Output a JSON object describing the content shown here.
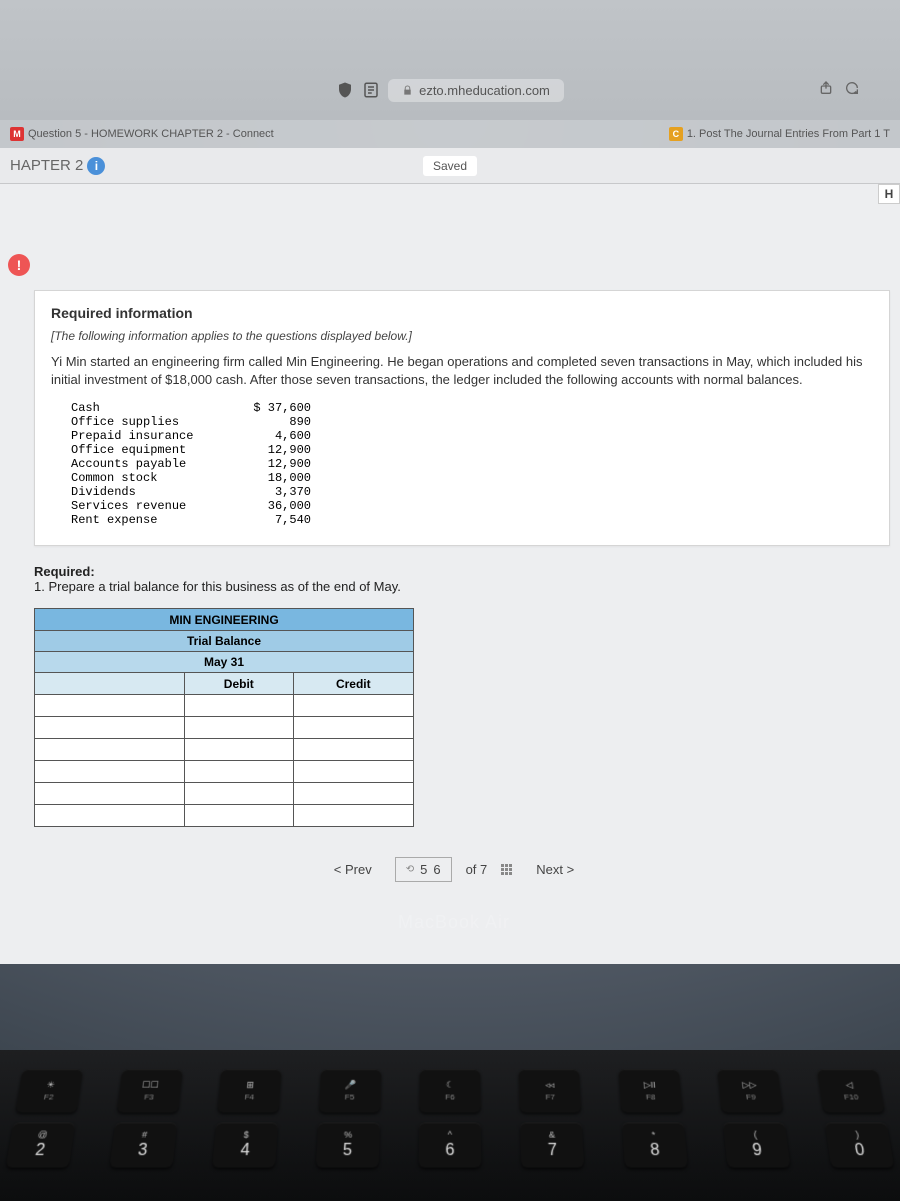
{
  "browser": {
    "url_host": "ezto.mheducation.com"
  },
  "tabs": {
    "left": {
      "icon": "M",
      "label": "Question 5 - HOMEWORK CHAPTER 2 - Connect"
    },
    "right": {
      "icon": "C",
      "label": "1. Post The Journal Entries From Part 1 T"
    }
  },
  "toolbar": {
    "chapter": "HAPTER 2",
    "saved": "Saved",
    "help": "H"
  },
  "alert_glyph": "!",
  "info_card": {
    "heading": "Required information",
    "instruction": "[The following information applies to the questions displayed below.]",
    "body": "Yi Min started an engineering firm called Min Engineering. He began operations and completed seven transactions in May, which included his initial investment of $18,000 cash. After those seven transactions, the ledger included the following accounts with normal balances."
  },
  "ledger": [
    {
      "name": "Cash",
      "amount": "$ 37,600"
    },
    {
      "name": "Office supplies",
      "amount": "890"
    },
    {
      "name": "Prepaid insurance",
      "amount": "4,600"
    },
    {
      "name": "Office equipment",
      "amount": "12,900"
    },
    {
      "name": "Accounts payable",
      "amount": "12,900"
    },
    {
      "name": "Common stock",
      "amount": "18,000"
    },
    {
      "name": "Dividends",
      "amount": "3,370"
    },
    {
      "name": "Services revenue",
      "amount": "36,000"
    },
    {
      "name": "Rent expense",
      "amount": "7,540"
    }
  ],
  "required": {
    "label": "Required:",
    "item1": "1. Prepare a trial balance for this business as of the end of May."
  },
  "trial_balance": {
    "title": "MIN ENGINEERING",
    "subtitle": "Trial Balance",
    "date": "May 31",
    "col_debit": "Debit",
    "col_credit": "Credit"
  },
  "nav": {
    "prev": "< Prev",
    "page_a": "5",
    "page_b": "6",
    "of": "of 7",
    "next": "Next >"
  },
  "device_label": "MacBook Air",
  "keyboard": {
    "fn_row": [
      {
        "icon": "☀",
        "fn": "F2"
      },
      {
        "icon": "☐☐",
        "fn": "F3"
      },
      {
        "icon": "⊞",
        "fn": "F4"
      },
      {
        "icon": "🎤",
        "fn": "F5"
      },
      {
        "icon": "☾",
        "fn": "F6"
      },
      {
        "icon": "◃◃",
        "fn": "F7"
      },
      {
        "icon": "▷II",
        "fn": "F8"
      },
      {
        "icon": "▷▷",
        "fn": "F9"
      },
      {
        "icon": "◁",
        "fn": "F10"
      }
    ],
    "num_row": [
      {
        "top": "@",
        "main": "2"
      },
      {
        "top": "#",
        "main": "3"
      },
      {
        "top": "$",
        "main": "4"
      },
      {
        "top": "%",
        "main": "5"
      },
      {
        "top": "^",
        "main": "6"
      },
      {
        "top": "&",
        "main": "7"
      },
      {
        "top": "*",
        "main": "8"
      },
      {
        "top": "(",
        "main": "9"
      },
      {
        "top": ")",
        "main": "0"
      }
    ]
  }
}
